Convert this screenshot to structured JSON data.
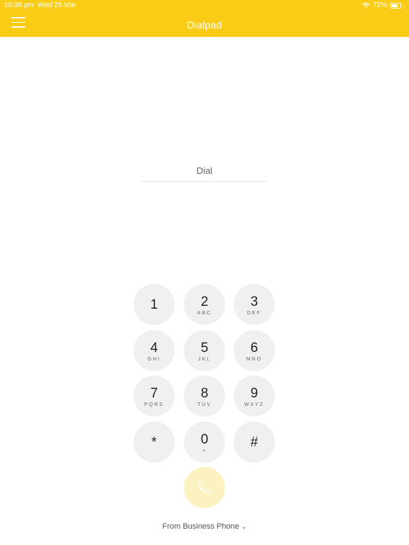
{
  "status_bar": {
    "time": "10:36 pm",
    "date": "Wed 25 Mar",
    "battery": "72%"
  },
  "header": {
    "title": "Dialpad"
  },
  "dial_input": {
    "placeholder": "Dial",
    "value": ""
  },
  "keys": [
    {
      "digit": "1",
      "letters": ""
    },
    {
      "digit": "2",
      "letters": "ABC"
    },
    {
      "digit": "3",
      "letters": "DEF"
    },
    {
      "digit": "4",
      "letters": "GHI"
    },
    {
      "digit": "5",
      "letters": "JKL"
    },
    {
      "digit": "6",
      "letters": "MNO"
    },
    {
      "digit": "7",
      "letters": "PQRS"
    },
    {
      "digit": "8",
      "letters": "TUV"
    },
    {
      "digit": "9",
      "letters": "WXYZ"
    },
    {
      "digit": "*",
      "letters": ""
    },
    {
      "digit": "0",
      "letters": "+"
    },
    {
      "digit": "#",
      "letters": ""
    }
  ],
  "footer": {
    "from_label": "From Business Phone"
  },
  "colors": {
    "accent": "#FACC15",
    "call_button": "#FCF1C1",
    "key_bg": "#F0F0F0"
  }
}
